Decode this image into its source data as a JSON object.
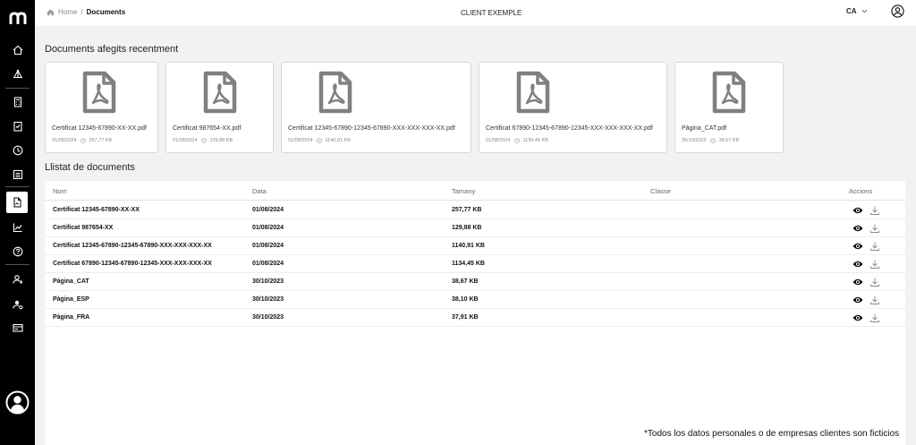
{
  "header": {
    "breadcrumb_home": "Home",
    "breadcrumb_sep": "/",
    "breadcrumb_current": "Documents",
    "client_name": "CLIENT EXEMPLE",
    "language": "CA"
  },
  "sidebar": {
    "items": [
      {
        "icon": "home-icon"
      },
      {
        "icon": "network-icon"
      },
      {
        "icon": "calculator-icon"
      },
      {
        "icon": "checklist-icon"
      },
      {
        "icon": "clock-icon"
      },
      {
        "icon": "list-icon"
      },
      {
        "icon": "document-icon",
        "active": true
      },
      {
        "icon": "chart-icon"
      },
      {
        "icon": "help-icon"
      },
      {
        "icon": "user-add-icon"
      },
      {
        "icon": "user-settings-icon"
      },
      {
        "icon": "card-icon"
      }
    ]
  },
  "recent": {
    "title": "Documents afegits recentment",
    "cards": [
      {
        "name": "Certificat 12345-67890-XX-XX.pdf",
        "date": "01/08/2024",
        "size": "257,77 KB"
      },
      {
        "name": "Certificat 987654-XX.pdf",
        "date": "01/08/2024",
        "size": "129,88 KB"
      },
      {
        "name": "Certificat 12345-67890-12345-67890-XXX-XXX-XXX-XX.pdf",
        "date": "01/08/2024",
        "size": "1140,91 KB"
      },
      {
        "name": "Certificat 67890-12345-67890-12345-XXX-XXX-XXX-XX.pdf",
        "date": "01/08/2024",
        "size": "1134,45 KB"
      },
      {
        "name": "Pàgina_CAT.pdf",
        "date": "30/10/2023",
        "size": "38,67 KB"
      }
    ]
  },
  "list": {
    "title": "Llistat de documents",
    "columns": {
      "name": "Nom",
      "date": "Data",
      "size": "Tamany",
      "class": "Classe",
      "actions": "Accions"
    },
    "rows": [
      {
        "name": "Certificat 12345-67890-XX-XX",
        "date": "01/08/2024",
        "size": "257,77 KB",
        "class": ""
      },
      {
        "name": "Certificat 987654-XX",
        "date": "01/08/2024",
        "size": "129,88 KB",
        "class": ""
      },
      {
        "name": "Certificat 12345-67890-12345-67890-XXX-XXX-XXX-XX",
        "date": "01/08/2024",
        "size": "1140,91 KB",
        "class": ""
      },
      {
        "name": "Certificat 67890-12345-67890-12345-XXX-XXX-XXX-XX",
        "date": "01/08/2024",
        "size": "1134,45 KB",
        "class": ""
      },
      {
        "name": "Pàgina_CAT",
        "date": "30/10/2023",
        "size": "38,67 KB",
        "class": ""
      },
      {
        "name": "Pàgina_ESP",
        "date": "30/10/2023",
        "size": "38,10 KB",
        "class": ""
      },
      {
        "name": "Pàgina_FRA",
        "date": "30/10/2023",
        "size": "37,91 KB",
        "class": ""
      }
    ]
  },
  "disclaimer": "*Todos los datos personales o de empresas clientes son ficticios"
}
